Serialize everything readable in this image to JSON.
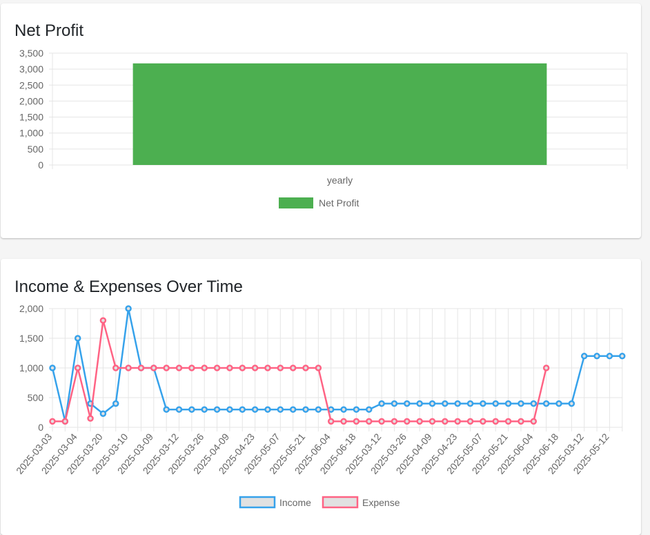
{
  "colors": {
    "net_profit": "#4caf50",
    "income": "#36a2eb",
    "expense": "#ff6384",
    "grid": "#e5e5e5",
    "legend_fill": "#e1e1e1"
  },
  "chart_data": [
    {
      "type": "bar",
      "title": "Net Profit",
      "categories": [
        "yearly"
      ],
      "series": [
        {
          "name": "Net Profit",
          "values": [
            3180
          ]
        }
      ],
      "ylim": [
        0,
        3500
      ],
      "yticks": [
        "3,500",
        "3,000",
        "2,500",
        "2,000",
        "1,500",
        "1,000",
        "500",
        "0"
      ],
      "grid": true,
      "legend_position": "bottom"
    },
    {
      "type": "line",
      "title": "Income & Expenses Over Time",
      "x": [
        "2025-03-03",
        "",
        "2025-03-04",
        "",
        "2025-03-20",
        "",
        "2025-03-10",
        "",
        "2025-03-09",
        "",
        "2025-03-12",
        "",
        "2025-03-26",
        "",
        "2025-04-09",
        "",
        "2025-04-23",
        "",
        "2025-05-07",
        "",
        "2025-05-21",
        "",
        "2025-06-04",
        "",
        "2025-06-18",
        "",
        "2025-03-12",
        "",
        "2025-03-26",
        "",
        "2025-04-09",
        "",
        "2025-04-23",
        "",
        "2025-05-07",
        "",
        "2025-05-21",
        "",
        "2025-06-04",
        "",
        "2025-06-18",
        "",
        "2025-03-12",
        "",
        "2025-05-12",
        ""
      ],
      "series": [
        {
          "name": "Income",
          "values": [
            1000,
            100,
            1500,
            400,
            230,
            400,
            2000,
            1000,
            1000,
            300,
            300,
            300,
            300,
            300,
            300,
            300,
            300,
            300,
            300,
            300,
            300,
            300,
            300,
            300,
            300,
            300,
            400,
            400,
            400,
            400,
            400,
            400,
            400,
            400,
            400,
            400,
            400,
            400,
            400,
            400,
            400,
            400,
            1200,
            1200,
            1200,
            1200
          ]
        },
        {
          "name": "Expense",
          "values": [
            100,
            100,
            1000,
            150,
            1800,
            1000,
            1000,
            1000,
            1000,
            1000,
            1000,
            1000,
            1000,
            1000,
            1000,
            1000,
            1000,
            1000,
            1000,
            1000,
            1000,
            1000,
            100,
            100,
            100,
            100,
            100,
            100,
            100,
            100,
            100,
            100,
            100,
            100,
            100,
            100,
            100,
            100,
            100,
            1000
          ]
        }
      ],
      "ylim": [
        0,
        2000
      ],
      "yticks": [
        "2,000",
        "1,500",
        "1,000",
        "500",
        "0"
      ],
      "grid": true,
      "legend_position": "bottom"
    }
  ]
}
